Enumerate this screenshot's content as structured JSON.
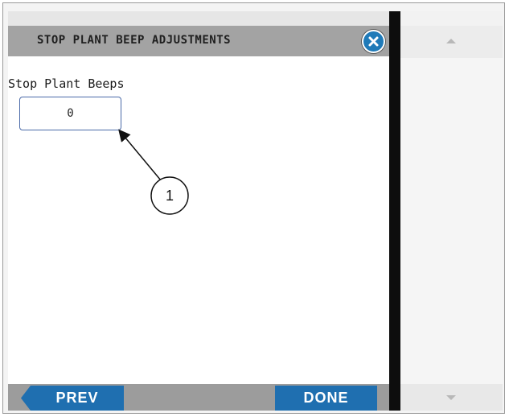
{
  "dialog": {
    "title": "STOP PLANT BEEP ADJUSTMENTS",
    "close_icon": "close-icon"
  },
  "field": {
    "label": "Stop Plant Beeps",
    "value": "0"
  },
  "callout": {
    "number": "1"
  },
  "footer": {
    "prev_label": "PREV",
    "done_label": "DONE"
  },
  "scroll": {
    "up_icon": "chevron-up-icon",
    "down_icon": "chevron-down-icon"
  },
  "colors": {
    "accent_blue": "#1f6fb0",
    "header_gray": "#a3a3a3"
  }
}
